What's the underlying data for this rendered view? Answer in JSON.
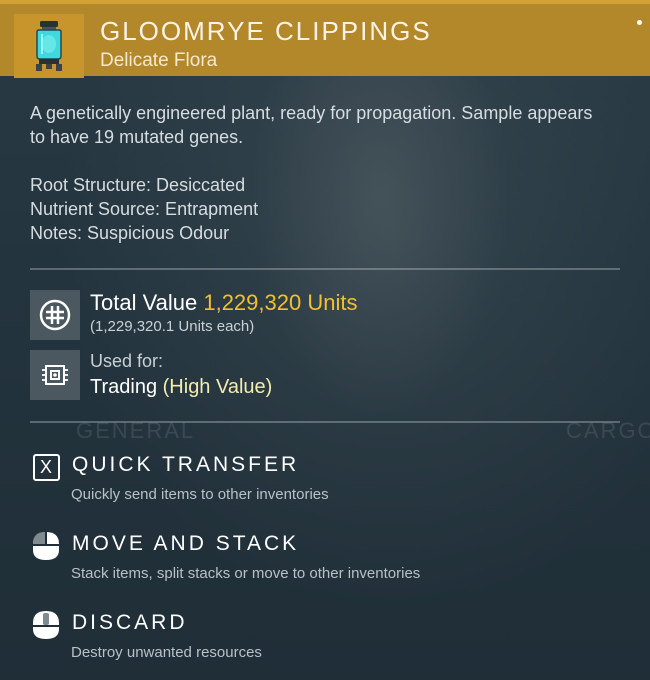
{
  "header": {
    "title": "GLOOMRYE CLIPPINGS",
    "subtitle": "Delicate Flora",
    "item_icon": "glass-specimen-jar-icon",
    "accent_color": "#b3882a"
  },
  "description": "A genetically engineered plant, ready for propagation. Sample appears to have 19 mutated genes.",
  "properties": [
    "Root Structure: Desiccated",
    "Nutrient Source: Entrapment",
    "Notes: Suspicious Odour"
  ],
  "value": {
    "label": "Total Value",
    "amount": "1,229,320 Units",
    "each": "(1,229,320.1 Units each)",
    "icon": "units-currency-icon",
    "amount_color": "#f2c02e"
  },
  "usage": {
    "label": "Used for:",
    "use": "Trading",
    "qualifier": "(High Value)",
    "icon": "trade-chip-icon"
  },
  "background_words": [
    "GENERAL",
    "CARGO"
  ],
  "actions": [
    {
      "key": "X",
      "title": "QUICK TRANSFER",
      "desc": "Quickly send items to other inventories",
      "icon": "keyboard-x-icon"
    },
    {
      "title": "MOVE AND STACK",
      "desc": "Stack items, split stacks or move to other inventories",
      "icon": "mouse-left-click-icon"
    },
    {
      "title": "DISCARD",
      "desc": "Destroy unwanted resources",
      "icon": "mouse-middle-click-icon"
    }
  ]
}
